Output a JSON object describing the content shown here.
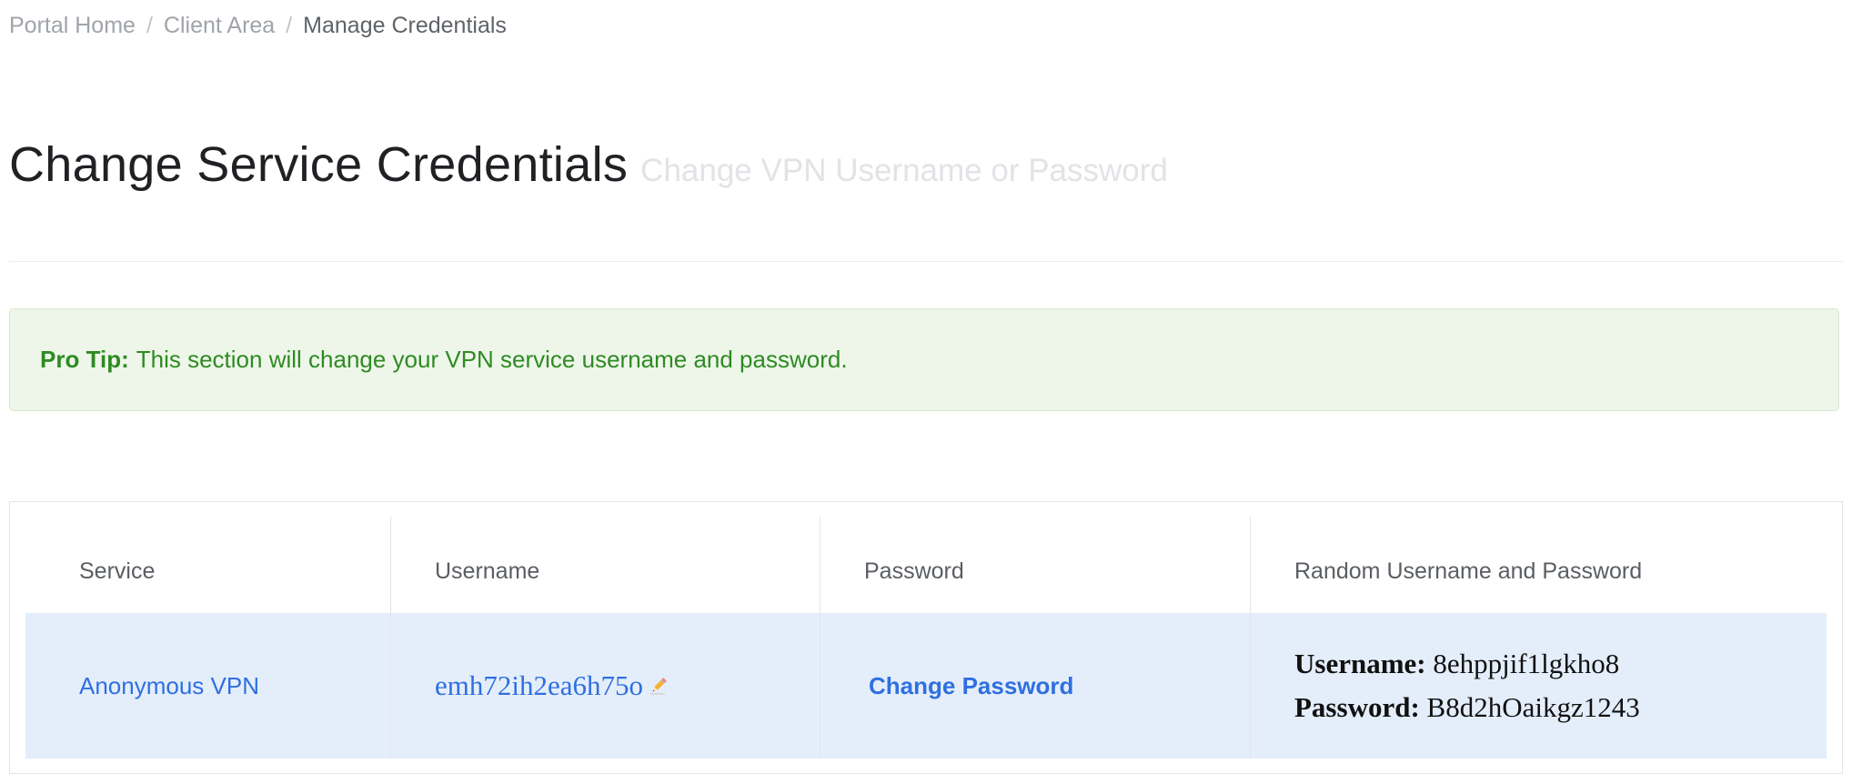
{
  "breadcrumb": {
    "items": [
      "Portal Home",
      "Client Area"
    ],
    "separator": "/",
    "current": "Manage Credentials"
  },
  "header": {
    "title": "Change Service Credentials",
    "subtitle": "Change VPN Username or Password"
  },
  "alert": {
    "label": "Pro Tip:",
    "text": "This section will change your VPN service username and password.",
    "color": "#2e8b22",
    "background": "#eef6ea"
  },
  "table": {
    "headers": {
      "service": "Service",
      "username": "Username",
      "password": "Password",
      "random": "Random Username and Password"
    },
    "rows": [
      {
        "service": "Anonymous VPN",
        "username": "emh72ih2ea6h75o",
        "edit_icon": "pencil-icon",
        "password_action": "Change Password",
        "random_username_label": "Username:",
        "random_username": "8ehppjif1lgkho8",
        "random_password_label": "Password:",
        "random_password": "B8d2hOaikgz1243"
      }
    ],
    "row_highlight": "#e4eefb",
    "link_color": "#2f6fe0"
  }
}
